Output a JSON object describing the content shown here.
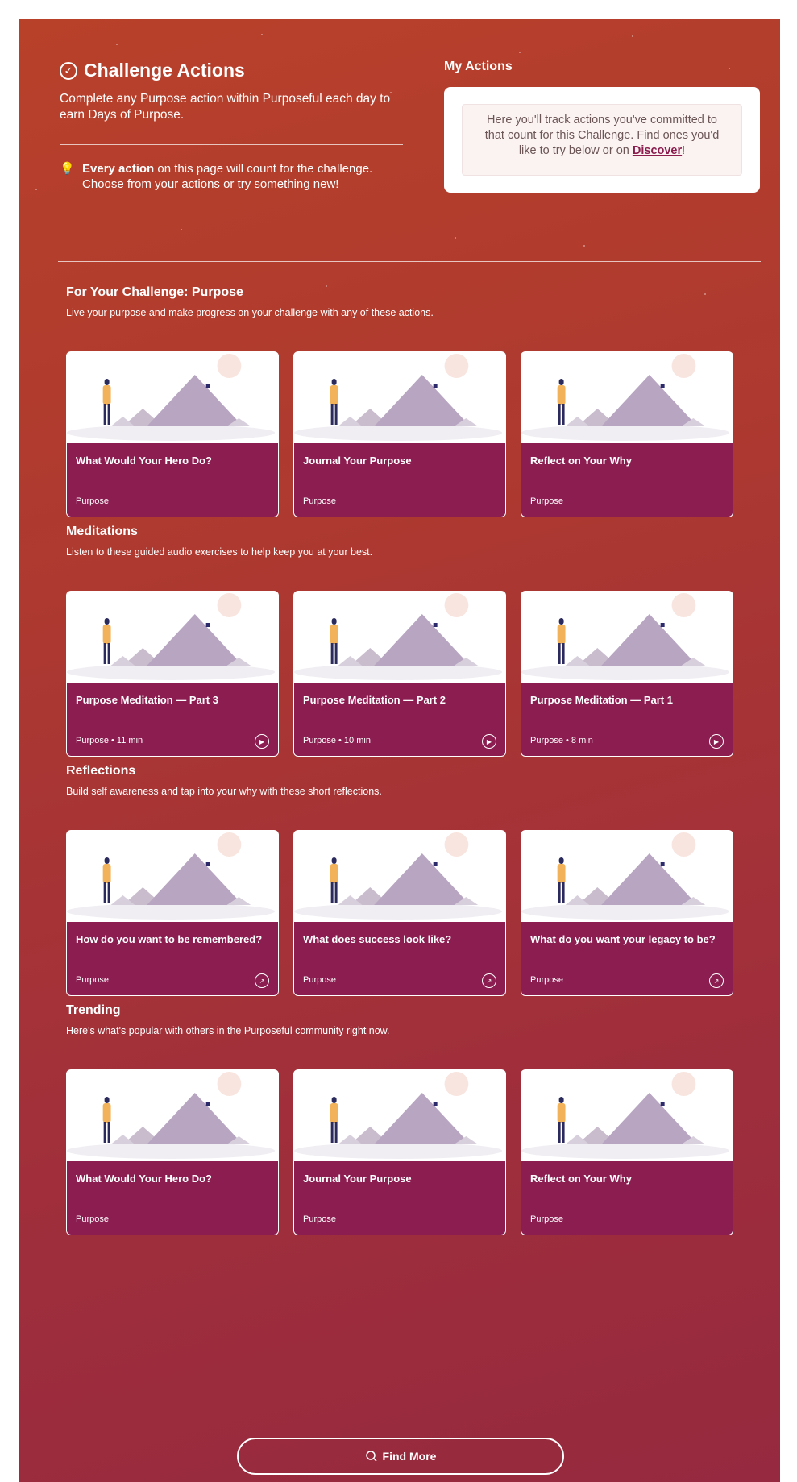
{
  "header": {
    "title": "Challenge Actions",
    "intro": "Complete any Purpose action within Purposeful each day to earn Days of Purpose.",
    "tip_bold": "Every action",
    "tip_rest": " on this page will count for the challenge. Choose from your actions or try something new!"
  },
  "my_actions": {
    "title": "My Actions",
    "text": "Here you'll track actions you've committed to that count for this Challenge. Find ones you'd like to try below or on ",
    "link": "Discover",
    "suffix": "!"
  },
  "sections": [
    {
      "title": "For Your Challenge: Purpose",
      "description": "Live your purpose and make progress on your challenge with any of these actions.",
      "cards": [
        {
          "title": "What Would Your Hero Do?",
          "meta": "Purpose",
          "action_icon": ""
        },
        {
          "title": "Journal Your Purpose",
          "meta": "Purpose",
          "action_icon": ""
        },
        {
          "title": "Reflect on Your Why",
          "meta": "Purpose",
          "action_icon": ""
        }
      ]
    },
    {
      "title": "Meditations",
      "description": "Listen to these guided audio exercises to help keep you at your best.",
      "cards": [
        {
          "title": "Purpose Meditation — Part 3",
          "meta": "Purpose • 11 min",
          "action_icon": "play-icon"
        },
        {
          "title": "Purpose Meditation — Part 2",
          "meta": "Purpose • 10 min",
          "action_icon": "play-icon"
        },
        {
          "title": "Purpose Meditation — Part 1",
          "meta": "Purpose • 8 min",
          "action_icon": "play-icon"
        }
      ]
    },
    {
      "title": "Reflections",
      "description": "Build self awareness and tap into your why with these short reflections.",
      "cards": [
        {
          "title": "How do you want to be remembered?",
          "meta": "Purpose",
          "action_icon": "arrow-icon"
        },
        {
          "title": "What does success look like?",
          "meta": "Purpose",
          "action_icon": "arrow-icon"
        },
        {
          "title": "What do you want your legacy to be?",
          "meta": "Purpose",
          "action_icon": "arrow-icon"
        }
      ]
    },
    {
      "title": "Trending",
      "description": "Here's what's popular with others in the Purposeful community right now.",
      "cards": [
        {
          "title": "What Would Your Hero Do?",
          "meta": "Purpose",
          "action_icon": ""
        },
        {
          "title": "Journal Your Purpose",
          "meta": "Purpose",
          "action_icon": ""
        },
        {
          "title": "Reflect on Your Why",
          "meta": "Purpose",
          "action_icon": ""
        }
      ]
    }
  ],
  "find_more": {
    "label": "Find More",
    "icon": "search-icon"
  },
  "colors": {
    "card_body": "#8b1d51",
    "background_top": "#b8412a",
    "background_bottom": "#96293f"
  }
}
